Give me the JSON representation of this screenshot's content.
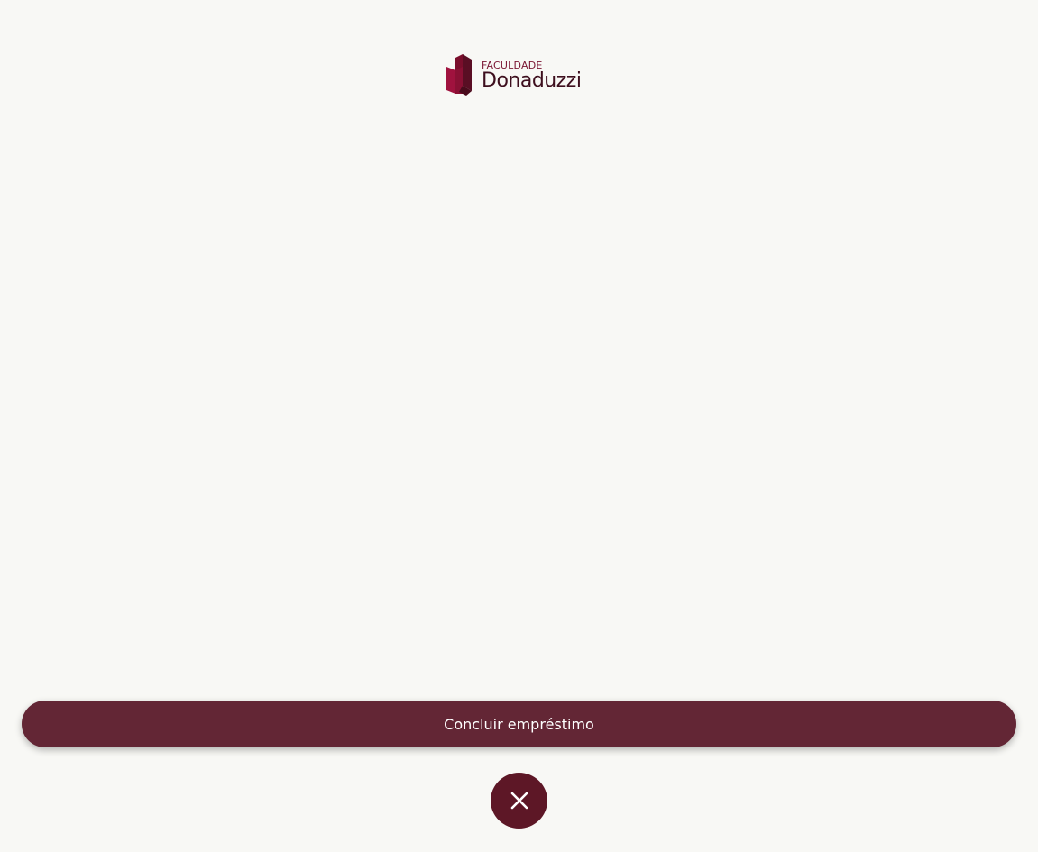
{
  "logo": {
    "top_text": "FACULDADE",
    "main_text": "Donaduzzi",
    "colors": {
      "mark_light": "#a0123e",
      "mark_dark": "#5a0e24",
      "top_text": "#7a1532",
      "main_text": "#3e0f1e"
    }
  },
  "actions": {
    "complete_label": "Concluir empréstimo",
    "complete_color": "#632635",
    "close_icon": "close-icon",
    "close_color": "#5d1726"
  },
  "background_color": "#f8f8f5"
}
